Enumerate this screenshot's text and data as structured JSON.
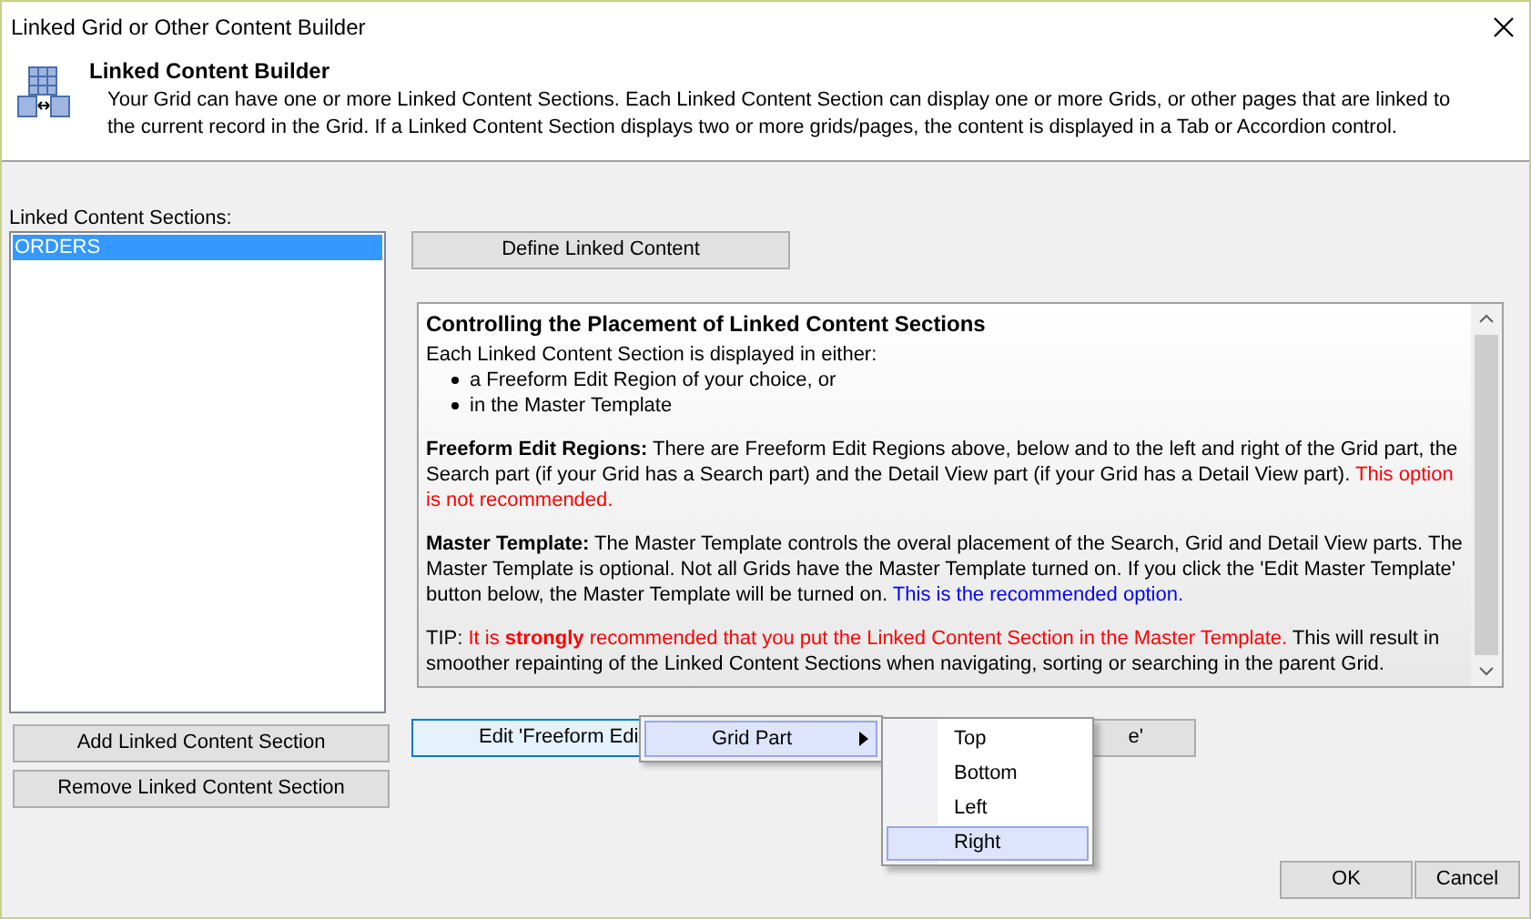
{
  "window": {
    "title": "Linked Grid or Other Content Builder"
  },
  "header": {
    "title": "Linked Content Builder",
    "description": "Your Grid can have one or more Linked Content Sections. Each Linked Content Section can display one or more Grids, or other pages that are linked to the current record in the Grid. If a Linked Content Section displays two or more grids/pages, the content is displayed in a Tab or Accordion control."
  },
  "sections": {
    "label": "Linked Content Sections:",
    "items": [
      {
        "label": "ORDERS",
        "selected": true
      }
    ]
  },
  "define_button": "Define Linked Content",
  "info": {
    "title": "Controlling the Placement of Linked Content Sections",
    "intro": "Each Linked Content Section is displayed in either:",
    "bullets": [
      "a Freeform Edit Region of your choice, or",
      "in the Master Template"
    ],
    "paragraphs": [
      [
        {
          "text": "**Freeform Edit Regions:** There are Freeform Edit Regions above, below and to the left and right of the Grid part, the Search part (if your Grid has a Search part) and the Detail View part (if your Grid has a Detail View part). ",
          "kind": "plain"
        },
        {
          "text": "This option is not recommended.",
          "kind": "warning"
        }
      ],
      [
        {
          "text": "**Master Template:** The Master Template controls the overal placement of the Search, Grid and Detail View parts. The Master Template is optional. Not all Grids have the Master Template turned on. If you click the 'Edit Master Template' button below, the Master Template will be turned on. ",
          "kind": "plain"
        },
        {
          "text": "This is the recommended option.",
          "kind": "note"
        }
      ],
      [
        {
          "text": "TIP: ",
          "kind": "plain"
        },
        {
          "text": "It is **strongly** recommended that you put the Linked Content Section in the Master Template.",
          "kind": "warning"
        },
        {
          "text": " This will result in smoother repainting of the Linked Content Sections when navigating, sorting or searching in the parent Grid.",
          "kind": "plain"
        }
      ]
    ]
  },
  "left_buttons": [
    "Add Linked Content Section",
    "Remove Linked Content Section"
  ],
  "edit_buttons": [
    {
      "label": "Edit 'Freeform Edi",
      "focused": true
    },
    {
      "label": "e'",
      "focused": false
    }
  ],
  "menu": {
    "items": [
      {
        "label": "Grid Part",
        "selected": true
      }
    ]
  },
  "submenu": {
    "items": [
      {
        "label": "Top",
        "selected": false
      },
      {
        "label": "Bottom",
        "selected": false
      },
      {
        "label": "Left",
        "selected": false
      },
      {
        "label": "Right",
        "selected": true
      }
    ]
  },
  "footer_buttons": [
    "OK",
    "Cancel"
  ]
}
